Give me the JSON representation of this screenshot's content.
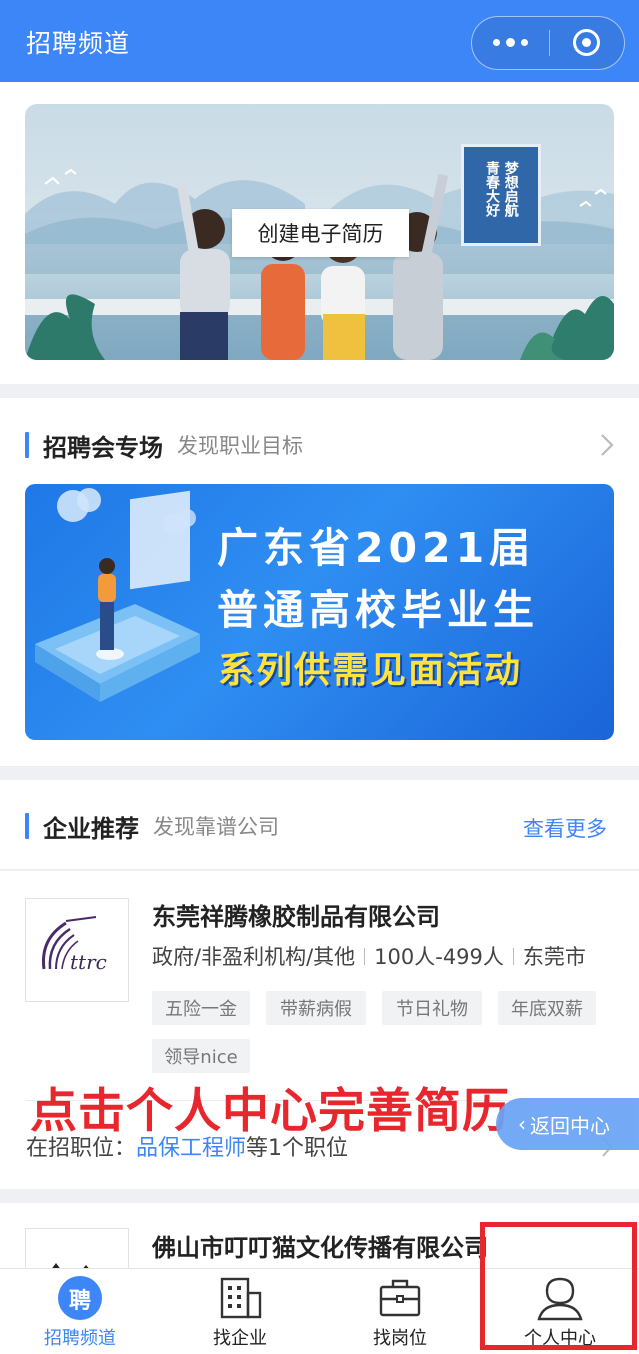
{
  "topbar": {
    "title": "招聘频道"
  },
  "hero": {
    "button_label": "创建电子简历",
    "slogan_col1": "梦想启航",
    "slogan_col2": "青春大好"
  },
  "fair_section": {
    "title": "招聘会专场",
    "subtitle": "发现职业目标",
    "banner_line1": "广东省2021届",
    "banner_line2": "普通高校毕业生",
    "banner_line3": "系列供需见面活动"
  },
  "company_section": {
    "title": "企业推荐",
    "subtitle": "发现靠谱公司",
    "more_label": "查看更多"
  },
  "companies": [
    {
      "logo_text": "ttrc",
      "name": "东莞祥腾橡胶制品有限公司",
      "type": "政府/非盈利机构/其他",
      "size": "100人-499人",
      "city": "东莞市",
      "tags": [
        "五险一金",
        "带薪病假",
        "节日礼物",
        "年底双薪",
        "领导nice"
      ],
      "jobs_prefix": "在招职位：",
      "jobs_link": "品保工程师",
      "jobs_suffix": "等1个职位"
    },
    {
      "name": "佛山市叮叮猫文化传播有限公司"
    }
  ],
  "overlay": {
    "annotation": "点击个人中心完善简历",
    "back_button": "返回中心"
  },
  "tabbar": {
    "tabs": [
      {
        "label": "招聘频道",
        "icon": "pin-icon",
        "badge": "聘",
        "active": true
      },
      {
        "label": "找企业",
        "icon": "building-icon"
      },
      {
        "label": "找岗位",
        "icon": "briefcase-icon"
      },
      {
        "label": "个人中心",
        "icon": "user-icon"
      }
    ]
  },
  "colors": {
    "accent": "#3d86f7",
    "annotation_red": "#e8262d",
    "slogan_yellow": "#ffe23d"
  }
}
